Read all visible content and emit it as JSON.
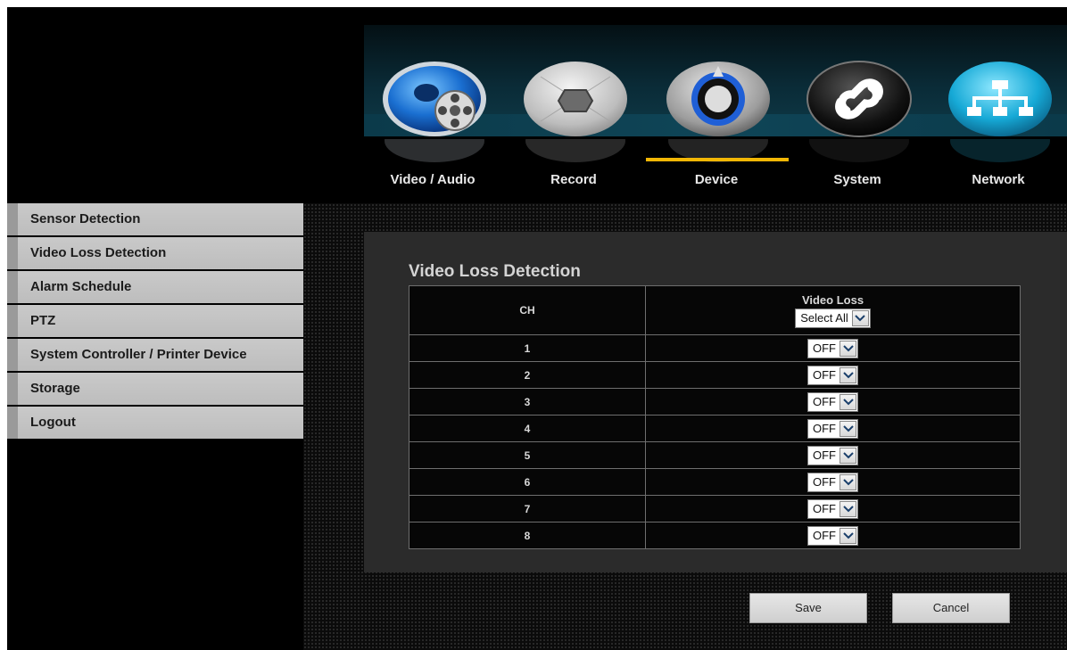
{
  "nav": {
    "tabs": [
      {
        "label": "Video / Audio",
        "icon": "video-audio-icon"
      },
      {
        "label": "Record",
        "icon": "camera-record-icon"
      },
      {
        "label": "Device",
        "icon": "device-knob-icon",
        "active": true
      },
      {
        "label": "System",
        "icon": "system-icon"
      },
      {
        "label": "Network",
        "icon": "network-icon"
      }
    ]
  },
  "sidebar": {
    "items": [
      {
        "label": "Sensor Detection"
      },
      {
        "label": "Video Loss Detection"
      },
      {
        "label": "Alarm Schedule"
      },
      {
        "label": "PTZ"
      },
      {
        "label": "System Controller / Printer Device"
      },
      {
        "label": "Storage"
      },
      {
        "label": "Logout"
      }
    ]
  },
  "main": {
    "title": "Video Loss Detection",
    "table": {
      "col_ch": "CH",
      "col_video_loss": "Video Loss",
      "select_all": "Select All",
      "rows": [
        {
          "ch": "1",
          "value": "OFF"
        },
        {
          "ch": "2",
          "value": "OFF"
        },
        {
          "ch": "3",
          "value": "OFF"
        },
        {
          "ch": "4",
          "value": "OFF"
        },
        {
          "ch": "5",
          "value": "OFF"
        },
        {
          "ch": "6",
          "value": "OFF"
        },
        {
          "ch": "7",
          "value": "OFF"
        },
        {
          "ch": "8",
          "value": "OFF"
        }
      ]
    }
  },
  "buttons": {
    "save": "Save",
    "cancel": "Cancel"
  },
  "colors": {
    "active_indicator": "#f2b705",
    "panel_bg": "#2b2b2b",
    "sidebar_bg": "#c4c4c4"
  }
}
